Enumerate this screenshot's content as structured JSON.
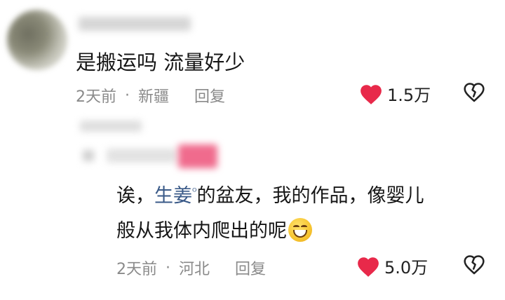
{
  "comment1": {
    "text": "是搬运吗 流量好少",
    "time": "2天前",
    "location": "新疆",
    "reply_label": "回复",
    "likes": "1.5万"
  },
  "comment2": {
    "prefix": "诶，",
    "mention": "生姜",
    "line1_rest": "的盆友，我的作品，像婴儿",
    "line2": "般从我体内爬出的呢",
    "time": "2天前",
    "location": "河北",
    "reply_label": "回复",
    "likes": "5.0万"
  },
  "icons": {
    "like": "heart-icon",
    "dislike": "broken-heart-icon",
    "mention": "search-icon",
    "emoji": "grinning-face-emoji"
  },
  "colors": {
    "like_red": "#e8294a",
    "meta_gray": "#8a8a8a",
    "link_blue": "#3a5a88"
  }
}
